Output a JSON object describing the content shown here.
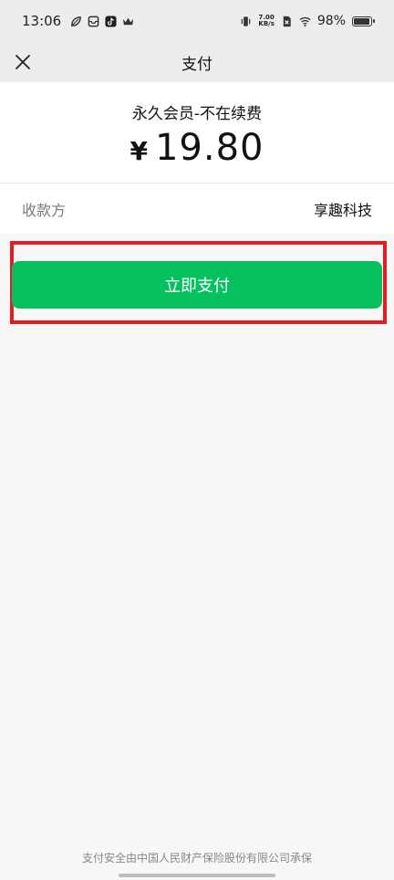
{
  "status_bar": {
    "time": "13:06",
    "net_speed_value": "7.00",
    "net_speed_unit": "KB/s",
    "battery": "98%",
    "battery_level": 0.98,
    "icons": [
      "leaf-icon",
      "inbox-icon",
      "tiktok-icon",
      "crown-icon",
      "vibrate-icon",
      "sim-off-icon",
      "wifi-icon",
      "battery-icon"
    ]
  },
  "nav": {
    "title": "支付",
    "close_icon": "close-icon"
  },
  "order": {
    "product_name": "永久会员-不在续费",
    "currency_symbol": "¥",
    "amount": "19.80"
  },
  "payee": {
    "label": "收款方",
    "value": "享趣科技"
  },
  "actions": {
    "pay_button_label": "立即支付",
    "highlight_color": "#e31b23",
    "button_color": "#07c160"
  },
  "footer": {
    "note": "支付安全由中国人民财产保险股份有限公司承保"
  }
}
